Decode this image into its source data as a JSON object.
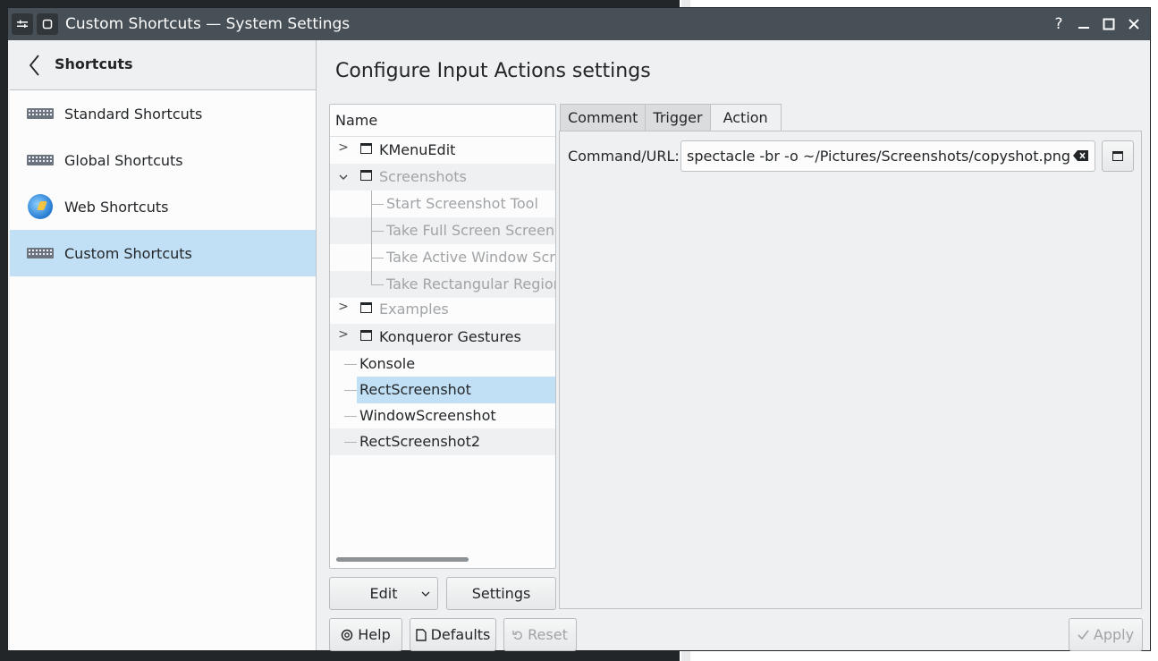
{
  "window": {
    "title": "Custom Shortcuts — System Settings",
    "controls": {
      "help": "?",
      "minimize": "—",
      "maximize": "☐",
      "close": "✕"
    }
  },
  "sidebar": {
    "back_icon": "back-arrow-icon",
    "title": "Shortcuts",
    "items": [
      {
        "label": "Standard Shortcuts",
        "icon": "keyboard-icon"
      },
      {
        "label": "Global Shortcuts",
        "icon": "keyboard-icon"
      },
      {
        "label": "Web Shortcuts",
        "icon": "globe-icon"
      },
      {
        "label": "Custom Shortcuts",
        "icon": "keyboard-icon",
        "active": true
      }
    ]
  },
  "main": {
    "title": "Configure Input Actions settings",
    "tree": {
      "header": "Name",
      "rows": [
        {
          "label": "KMenuEdit",
          "type": "folder",
          "expand": ">"
        },
        {
          "label": "Screenshots",
          "type": "folder",
          "expand": "v",
          "disabled": true
        },
        {
          "label": "Start Screenshot Tool",
          "type": "child",
          "disabled": true
        },
        {
          "label": "Take Full Screen Screenshot",
          "type": "child",
          "disabled": true
        },
        {
          "label": "Take Active Window Screenshot",
          "type": "child",
          "disabled": true
        },
        {
          "label": "Take Rectangular Region Screenshot",
          "type": "child",
          "disabled": true
        },
        {
          "label": "Examples",
          "type": "folder",
          "expand": ">",
          "disabled": true
        },
        {
          "label": "Konqueror Gestures",
          "type": "folder",
          "expand": ">"
        },
        {
          "label": "Konsole",
          "type": "item"
        },
        {
          "label": "RectScreenshot",
          "type": "item",
          "selected": true
        },
        {
          "label": "WindowScreenshot",
          "type": "item"
        },
        {
          "label": "RectScreenshot2",
          "type": "item"
        }
      ]
    },
    "tree_buttons": {
      "edit": "Edit",
      "settings": "Settings"
    },
    "tabs": [
      "Comment",
      "Trigger",
      "Action"
    ],
    "active_tab": "Action",
    "action": {
      "command_label": "Command/URL:",
      "command_value": "spectacle -br -o ~/Pictures/Screenshots/copyshot.png"
    },
    "footer": {
      "help": "Help",
      "defaults": "Defaults",
      "reset": "Reset",
      "apply": "Apply"
    }
  },
  "colors": {
    "selection": "#c2e0f5",
    "titlebar": "#475057",
    "window_bg": "#eff0f1"
  }
}
